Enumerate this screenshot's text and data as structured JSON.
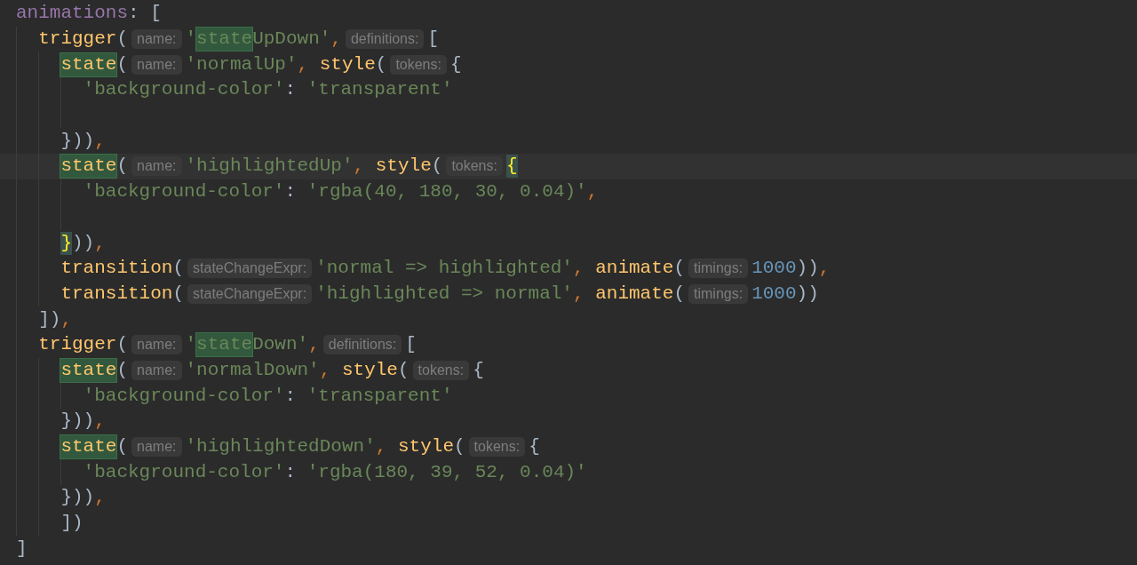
{
  "editor": {
    "lines": [
      {
        "kind": "code",
        "tokens": [
          {
            "kind": "prop",
            "t": "animations"
          },
          {
            "kind": "punct",
            "t": ": ["
          }
        ],
        "children": [
          {
            "kind": "code",
            "tokens": [
              {
                "kind": "fn",
                "t": "trigger"
              },
              {
                "kind": "punct",
                "t": "("
              },
              {
                "kind": "hint",
                "t": "name:"
              },
              {
                "kind": "str",
                "t": "'"
              },
              {
                "kind": "str",
                "t": "state",
                "search_hit": true
              },
              {
                "kind": "str",
                "t": "UpDown'"
              },
              {
                "kind": "comma",
                "t": ","
              },
              {
                "kind": "hint",
                "t": "definitions:"
              },
              {
                "kind": "punct",
                "t": "["
              }
            ],
            "children": [
              {
                "kind": "code",
                "tokens": [
                  {
                    "kind": "fn",
                    "t": "state",
                    "search_hit": true
                  },
                  {
                    "kind": "punct",
                    "t": "("
                  },
                  {
                    "kind": "hint",
                    "t": "name:"
                  },
                  {
                    "kind": "str",
                    "t": "'normalUp'"
                  },
                  {
                    "kind": "comma",
                    "t": ", "
                  },
                  {
                    "kind": "fn",
                    "t": "style"
                  },
                  {
                    "kind": "punct",
                    "t": "("
                  },
                  {
                    "kind": "hint",
                    "t": "tokens:"
                  },
                  {
                    "kind": "punct",
                    "t": "{"
                  }
                ],
                "children": [
                  {
                    "kind": "code",
                    "tokens": [
                      {
                        "kind": "str",
                        "t": "'background-color'"
                      },
                      {
                        "kind": "punct",
                        "t": ": "
                      },
                      {
                        "kind": "str",
                        "t": "'transparent'"
                      }
                    ]
                  },
                  {
                    "kind": "blank"
                  }
                ]
              },
              {
                "kind": "code",
                "tokens": [
                  {
                    "kind": "punct",
                    "t": "}))"
                  },
                  {
                    "kind": "comma",
                    "t": ","
                  }
                ]
              },
              {
                "kind": "code",
                "current": true,
                "tokens": [
                  {
                    "kind": "fn",
                    "t": "state",
                    "search_hit": true
                  },
                  {
                    "kind": "punct",
                    "t": "("
                  },
                  {
                    "kind": "hint",
                    "t": "name:"
                  },
                  {
                    "kind": "str",
                    "t": "'highlightedUp'"
                  },
                  {
                    "kind": "comma",
                    "t": ", "
                  },
                  {
                    "kind": "fn",
                    "t": "style"
                  },
                  {
                    "kind": "punct",
                    "t": "("
                  },
                  {
                    "kind": "hint",
                    "t": "tokens:"
                  },
                  {
                    "kind": "punct",
                    "t": "{",
                    "brace_match": true
                  }
                ],
                "children": [
                  {
                    "kind": "code",
                    "tokens": [
                      {
                        "kind": "str",
                        "t": "'background-color'"
                      },
                      {
                        "kind": "punct",
                        "t": ": "
                      },
                      {
                        "kind": "str",
                        "t": "'rgba(40, 180, 30, 0.04)'"
                      },
                      {
                        "kind": "comma",
                        "t": ","
                      }
                    ]
                  },
                  {
                    "kind": "blank"
                  }
                ]
              },
              {
                "kind": "code",
                "tokens": [
                  {
                    "kind": "punct",
                    "t": "}",
                    "brace_match": true
                  },
                  {
                    "kind": "punct",
                    "t": "))"
                  },
                  {
                    "kind": "comma",
                    "t": ","
                  }
                ]
              },
              {
                "kind": "code",
                "tokens": [
                  {
                    "kind": "fn",
                    "t": "transition"
                  },
                  {
                    "kind": "punct",
                    "t": "("
                  },
                  {
                    "kind": "hint",
                    "t": "stateChangeExpr:"
                  },
                  {
                    "kind": "str",
                    "t": "'normal => highlighted'"
                  },
                  {
                    "kind": "comma",
                    "t": ", "
                  },
                  {
                    "kind": "fn",
                    "t": "animate"
                  },
                  {
                    "kind": "punct",
                    "t": "("
                  },
                  {
                    "kind": "hint",
                    "t": "timings:"
                  },
                  {
                    "kind": "num",
                    "t": "1000"
                  },
                  {
                    "kind": "punct",
                    "t": "))"
                  },
                  {
                    "kind": "comma",
                    "t": ","
                  }
                ]
              },
              {
                "kind": "code",
                "tokens": [
                  {
                    "kind": "fn",
                    "t": "transition"
                  },
                  {
                    "kind": "punct",
                    "t": "("
                  },
                  {
                    "kind": "hint",
                    "t": "stateChangeExpr:"
                  },
                  {
                    "kind": "str",
                    "t": "'highlighted => normal'"
                  },
                  {
                    "kind": "comma",
                    "t": ", "
                  },
                  {
                    "kind": "fn",
                    "t": "animate"
                  },
                  {
                    "kind": "punct",
                    "t": "("
                  },
                  {
                    "kind": "hint",
                    "t": "timings:"
                  },
                  {
                    "kind": "num",
                    "t": "1000"
                  },
                  {
                    "kind": "punct",
                    "t": "))"
                  }
                ]
              }
            ]
          },
          {
            "kind": "code",
            "tokens": [
              {
                "kind": "punct",
                "t": "])"
              },
              {
                "kind": "comma",
                "t": ","
              }
            ]
          },
          {
            "kind": "code",
            "tokens": [
              {
                "kind": "fn",
                "t": "trigger"
              },
              {
                "kind": "punct",
                "t": "("
              },
              {
                "kind": "hint",
                "t": "name:"
              },
              {
                "kind": "str",
                "t": "'"
              },
              {
                "kind": "str",
                "t": "state",
                "search_hit": true
              },
              {
                "kind": "str",
                "t": "Down'"
              },
              {
                "kind": "comma",
                "t": ","
              },
              {
                "kind": "hint",
                "t": "definitions:"
              },
              {
                "kind": "punct",
                "t": "["
              }
            ],
            "children": [
              {
                "kind": "code",
                "tokens": [
                  {
                    "kind": "fn",
                    "t": "state",
                    "search_hit": true
                  },
                  {
                    "kind": "punct",
                    "t": "("
                  },
                  {
                    "kind": "hint",
                    "t": "name:"
                  },
                  {
                    "kind": "str",
                    "t": "'normalDown'"
                  },
                  {
                    "kind": "comma",
                    "t": ", "
                  },
                  {
                    "kind": "fn",
                    "t": "style"
                  },
                  {
                    "kind": "punct",
                    "t": "("
                  },
                  {
                    "kind": "hint",
                    "t": "tokens:"
                  },
                  {
                    "kind": "punct",
                    "t": "{"
                  }
                ],
                "children": [
                  {
                    "kind": "code",
                    "tokens": [
                      {
                        "kind": "str",
                        "t": "'background-color'"
                      },
                      {
                        "kind": "punct",
                        "t": ": "
                      },
                      {
                        "kind": "str",
                        "t": "'transparent'"
                      }
                    ]
                  }
                ]
              },
              {
                "kind": "code",
                "tokens": [
                  {
                    "kind": "punct",
                    "t": "}))"
                  },
                  {
                    "kind": "comma",
                    "t": ","
                  }
                ]
              },
              {
                "kind": "code",
                "tokens": [
                  {
                    "kind": "fn",
                    "t": "state",
                    "search_hit": true
                  },
                  {
                    "kind": "punct",
                    "t": "("
                  },
                  {
                    "kind": "hint",
                    "t": "name:"
                  },
                  {
                    "kind": "str",
                    "t": "'highlightedDown'"
                  },
                  {
                    "kind": "comma",
                    "t": ", "
                  },
                  {
                    "kind": "fn",
                    "t": "style"
                  },
                  {
                    "kind": "punct",
                    "t": "("
                  },
                  {
                    "kind": "hint",
                    "t": "tokens:"
                  },
                  {
                    "kind": "punct",
                    "t": "{"
                  }
                ],
                "children": [
                  {
                    "kind": "code",
                    "tokens": [
                      {
                        "kind": "str",
                        "t": "'background-color'"
                      },
                      {
                        "kind": "punct",
                        "t": ": "
                      },
                      {
                        "kind": "str",
                        "t": "'rgba(180, 39, 52, 0.04)'"
                      }
                    ]
                  }
                ]
              },
              {
                "kind": "code",
                "tokens": [
                  {
                    "kind": "punct",
                    "t": "}))"
                  },
                  {
                    "kind": "comma",
                    "t": ","
                  }
                ]
              },
              {
                "kind": "code",
                "tokens": [
                  {
                    "kind": "punct",
                    "t": "])"
                  }
                ]
              }
            ]
          }
        ]
      },
      {
        "kind": "code",
        "tokens": [
          {
            "kind": "punct",
            "t": "]"
          }
        ]
      }
    ]
  }
}
